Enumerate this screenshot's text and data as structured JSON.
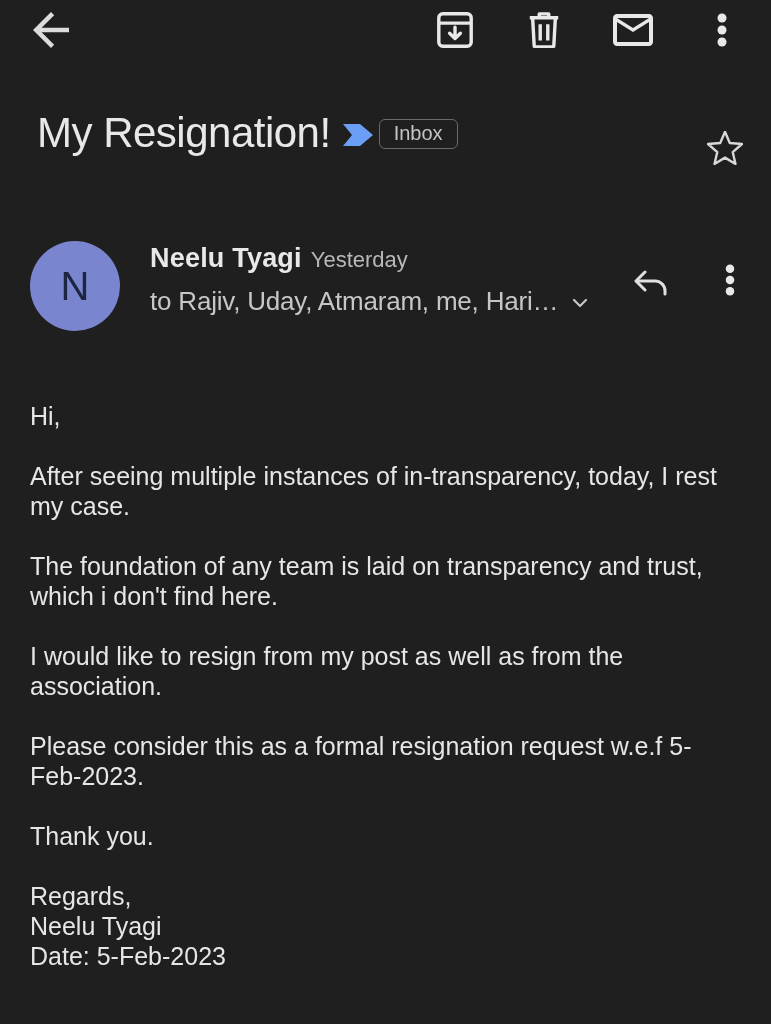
{
  "subject": {
    "title": "My Resignation!",
    "important": true,
    "label": "Inbox",
    "starred": false
  },
  "sender": {
    "initial": "N",
    "name": "Neelu Tyagi",
    "time": "Yesterday",
    "recipients": "to Rajiv, Uday, Atmaram, me, Hari…",
    "details_expanded": false
  },
  "body": {
    "greeting": "Hi,",
    "paragraphs": [
      "After seeing multiple instances of in-transparency, today, I rest my case.",
      "The foundation of any team is laid on transparency and trust, which i don't find here.",
      "I would like to resign from my post as well as from the association.",
      "Please consider this as a formal resignation request w.e.f 5-Feb-2023.",
      "Thank you."
    ],
    "signature": [
      "Regards,",
      "Neelu Tyagi",
      "Date: 5-Feb-2023"
    ]
  }
}
